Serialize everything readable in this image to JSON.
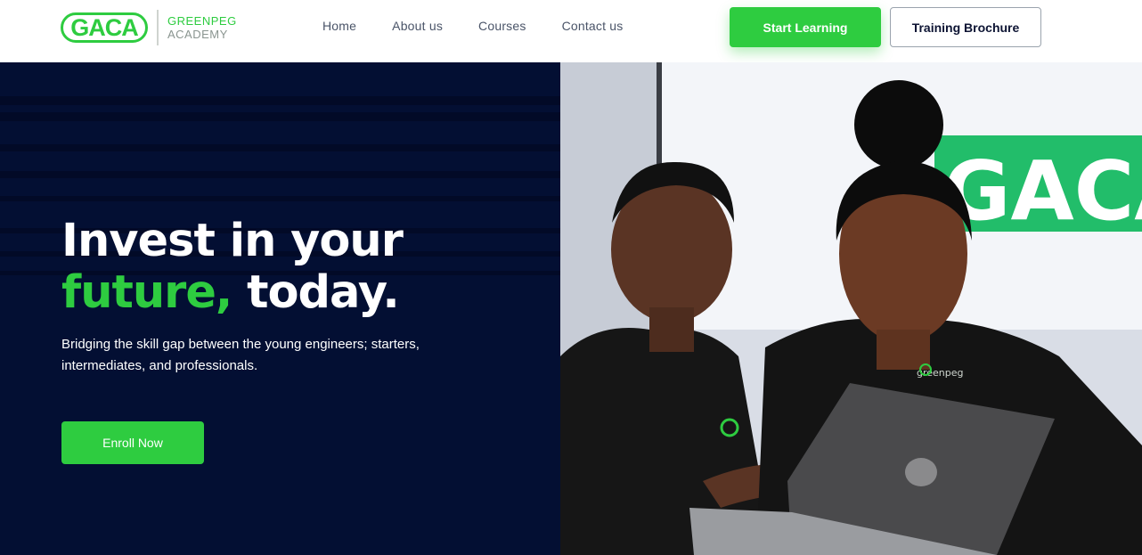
{
  "header": {
    "logo": {
      "mark": "GACA",
      "line1": "GREENPEG",
      "line2": "ACADEMY"
    },
    "nav": [
      "Home",
      "About us",
      "Courses",
      "Contact us"
    ],
    "start_label": "Start Learning",
    "brochure_label": "Training Brochure"
  },
  "hero": {
    "title_line1": "Invest in your",
    "title_accent": "future,",
    "title_rest": " today.",
    "subtitle": "Bridging the skill gap between the young engineers; starters, intermediates, and professionals.",
    "cta_label": "Enroll Now",
    "photo": {
      "sign_text": "GACA",
      "shirt_brand": "greenpeg"
    }
  },
  "colors": {
    "brand_green": "#2ecc40",
    "navy": "#030f33",
    "nav_text": "#4a5468"
  }
}
